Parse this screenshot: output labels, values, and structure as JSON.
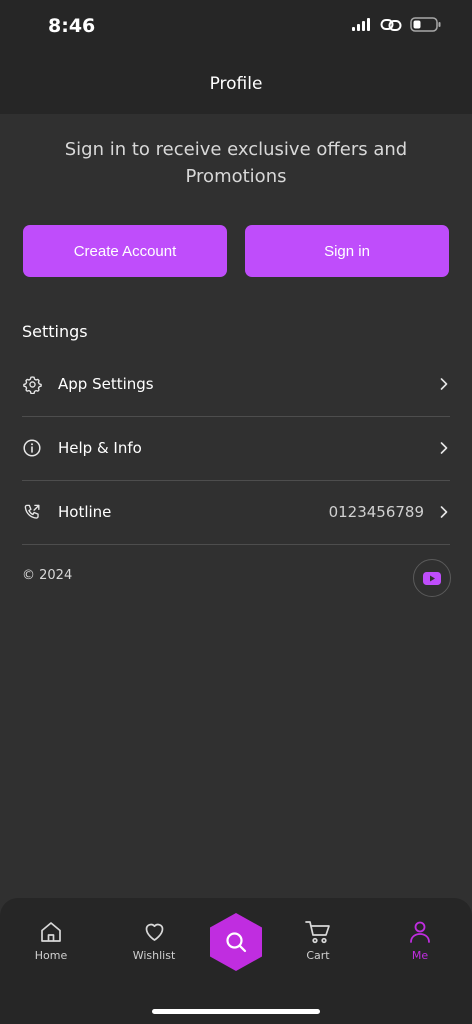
{
  "status_bar": {
    "time": "8:46"
  },
  "header": {
    "title": "Profile"
  },
  "promo": {
    "text": "Sign in to receive exclusive offers and Promotions"
  },
  "buttons": {
    "create_account": "Create Account",
    "sign_in": "Sign in"
  },
  "settings": {
    "title": "Settings",
    "items": [
      {
        "label": "App Settings",
        "icon": "gear-icon",
        "value": ""
      },
      {
        "label": "Help & Info",
        "icon": "info-icon",
        "value": ""
      },
      {
        "label": "Hotline",
        "icon": "phone-icon",
        "value": "0123456789"
      }
    ]
  },
  "footer": {
    "copyright": "© 2024",
    "social_icon": "youtube-icon"
  },
  "bottom_nav": {
    "items": [
      {
        "label": "Home",
        "icon": "home-icon"
      },
      {
        "label": "Wishlist",
        "icon": "heart-icon"
      },
      {
        "label": "",
        "icon": "search-icon"
      },
      {
        "label": "Cart",
        "icon": "cart-icon"
      },
      {
        "label": "Me",
        "icon": "user-icon"
      }
    ]
  },
  "colors": {
    "accent": "#bf4dfb",
    "active_nav": "#c02de0",
    "background": "#303030",
    "bar": "#262626"
  }
}
